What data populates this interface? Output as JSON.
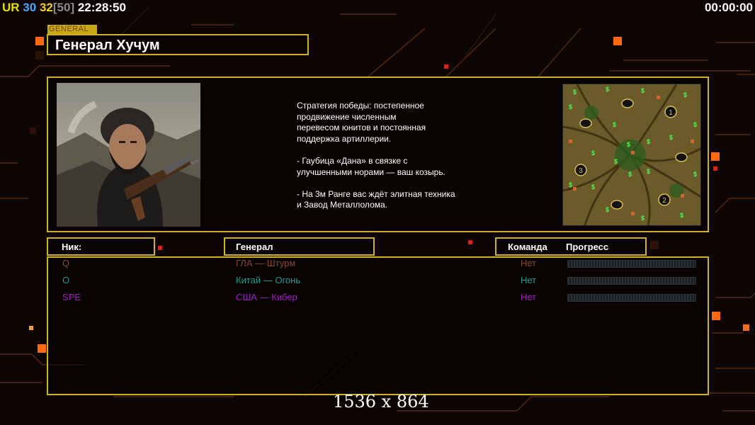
{
  "hud": {
    "ur_label": "UR",
    "num_a": "30",
    "num_b": "32",
    "num_c": "[50]",
    "time": "22:28:50",
    "game_timer": "00:00:00"
  },
  "general": {
    "tag": "GENERAL",
    "name": "Генерал Хучум",
    "description": "Стратегия победы: постепенное\nпродвижение численным\nперевесом юнитов и постоянная\nподдержка артиллерии.\n\n- Гаубица «Дана» в связке с\nулучшенными норами — ваш козырь.\n\n- На 3м Ранге вас ждёт элитная техника\nи Завод Металлолома."
  },
  "map_markers": [
    "1",
    "2",
    "3"
  ],
  "table": {
    "headers": {
      "nick": "Ник:",
      "general": "Генерал",
      "team": "Команда",
      "progress": "Прогресс"
    },
    "rows": [
      {
        "nick": "Q",
        "general": "ГЛА — Штурм",
        "team": "Нет",
        "color": "#8a4a2a",
        "progress": 0
      },
      {
        "nick": "O",
        "general": "Китай — Огонь",
        "team": "Нет",
        "color": "#1f9a95",
        "progress": 0
      },
      {
        "nick": "SPE",
        "general": "США — Кибер",
        "team": "Нет",
        "color": "#a01ec0",
        "progress": 0
      }
    ]
  },
  "overlay_resolution": "1536 x 864",
  "colors": {
    "accent_gold": "#d2b21c",
    "ur_yellow": "#e8e000",
    "num_a": "#4aa8ff",
    "num_b": "#f3d21e",
    "num_c": "#8a8a8a"
  }
}
